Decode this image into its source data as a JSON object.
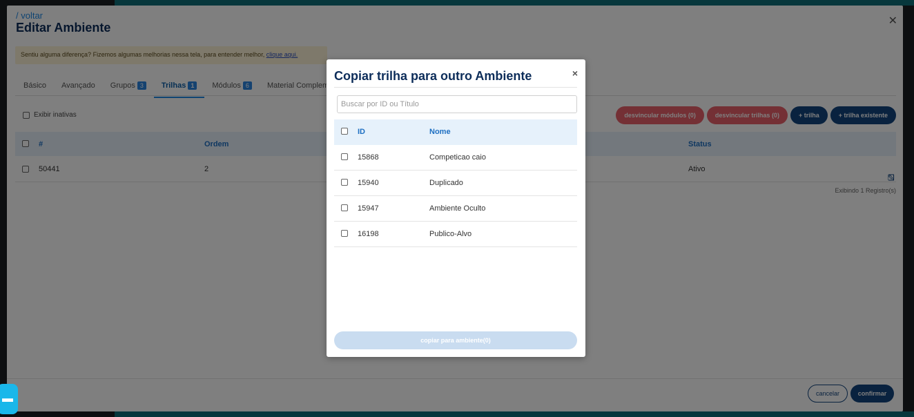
{
  "page": {
    "back_link": "/ voltar",
    "title": "Editar Ambiente",
    "notice_text": "Sentiu alguma diferença? Fizemos algumas melhorias nessa tela, para entender melhor,",
    "notice_link": "clique aqui."
  },
  "tabs": [
    {
      "label": "Básico"
    },
    {
      "label": "Avançado"
    },
    {
      "label": "Grupos",
      "count": "3"
    },
    {
      "label": "Trilhas",
      "count": "1",
      "active": true
    },
    {
      "label": "Módulos",
      "count": "6"
    },
    {
      "label": "Material Compleme"
    }
  ],
  "toolbar": {
    "show_inactive": "Exibir inativas",
    "unlink_modules": "desvincular módulos (0)",
    "unlink_trilhas": "desvincular trilhas (0)",
    "add_trilha": "+ trilha",
    "add_existing_trilha": "+ trilha existente"
  },
  "main_table": {
    "headers": {
      "id": "#",
      "order": "Ordem",
      "status": "Status"
    },
    "rows": [
      {
        "id": "50441",
        "order": "2",
        "status": "Ativo"
      }
    ],
    "footer": "Exibindo 1 Registro(s)"
  },
  "footer": {
    "cancel": "cancelar",
    "confirm": "confirmar"
  },
  "modal": {
    "title": "Copiar trilha para outro Ambiente",
    "close": "×",
    "search_placeholder": "Buscar por ID ou Título",
    "headers": {
      "id": "ID",
      "name": "Nome"
    },
    "rows": [
      {
        "id": "15868",
        "name": "Competicao caio"
      },
      {
        "id": "15940",
        "name": "Duplicado"
      },
      {
        "id": "15947",
        "name": "Ambiente Oculto"
      },
      {
        "id": "16198",
        "name": "Publico-Alvo"
      }
    ],
    "copy_button": "copiar para ambiente(0)"
  },
  "colors": {
    "navy": "#13457e",
    "accent_blue": "#1e88e5",
    "danger": "#e8606b",
    "header_bg": "#e6f1fb",
    "chat": "#1ab7ea"
  }
}
